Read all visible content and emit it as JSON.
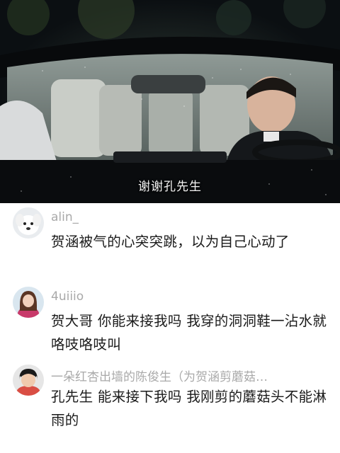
{
  "video": {
    "subtitle": "谢谢孔先生"
  },
  "comments": [
    {
      "username": "alin_",
      "text": "贺涵被气的心突突跳，以为自己心动了",
      "avatar": "white-dog-avatar"
    },
    {
      "username": "4uiiio",
      "text": "贺大哥 你能来接我吗 我穿的洞洞鞋一沾水就咯吱咯吱叫",
      "avatar": "girl-avatar"
    },
    {
      "username": "一朵红杏出墙的陈俊生（为贺涵剪蘑菇…",
      "text": "孔先生 能来接下我吗 我刚剪的蘑菇头不能淋雨的",
      "avatar": "child-avatar"
    }
  ],
  "colors": {
    "username": "#a9a9a9",
    "comment_text": "#1a1a1a",
    "subtitle": "#f4f4f4"
  }
}
